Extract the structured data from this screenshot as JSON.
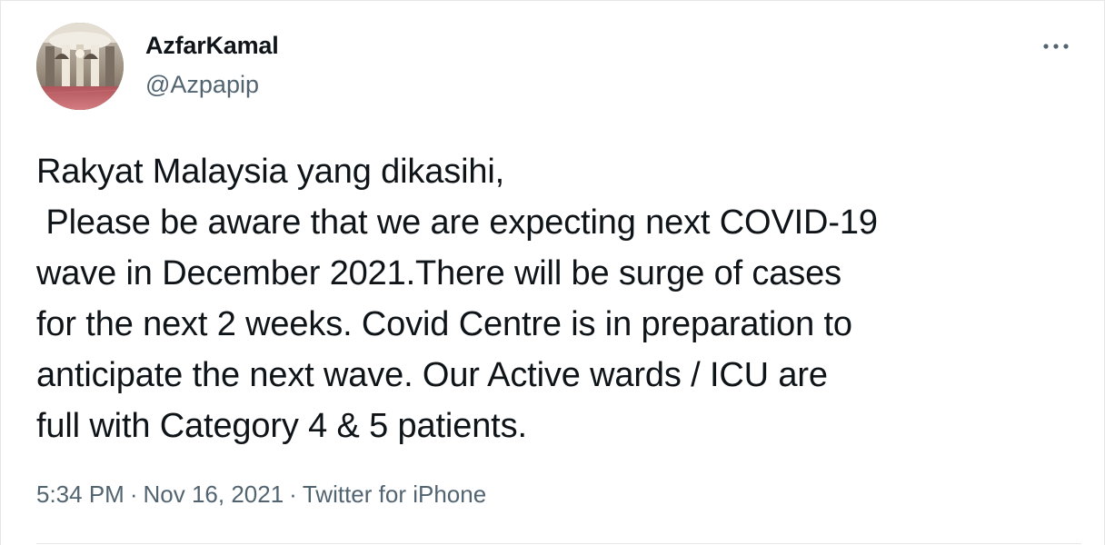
{
  "author": {
    "display_name": "AzfarKamal",
    "handle": "@Azpapip",
    "avatar_icon": "mosque-interior-photo"
  },
  "menu": {
    "icon": "more-options-icon"
  },
  "tweet": {
    "lines": [
      "Rakyat Malaysia yang dikasihi,",
      " Please be aware that we are expecting next COVID-19",
      "wave in December 2021.There will be surge of cases",
      "for the next 2 weeks. Covid Centre is in preparation to",
      "anticipate the next wave. Our Active wards / ICU are",
      "full with Category 4 & 5 patients."
    ]
  },
  "meta": {
    "time": "5:34 PM",
    "separator": "·",
    "date": "Nov 16, 2021",
    "source": "Twitter for iPhone"
  },
  "colors": {
    "text_primary": "#0f1419",
    "text_secondary": "#536471",
    "border": "#e4e6e8"
  }
}
